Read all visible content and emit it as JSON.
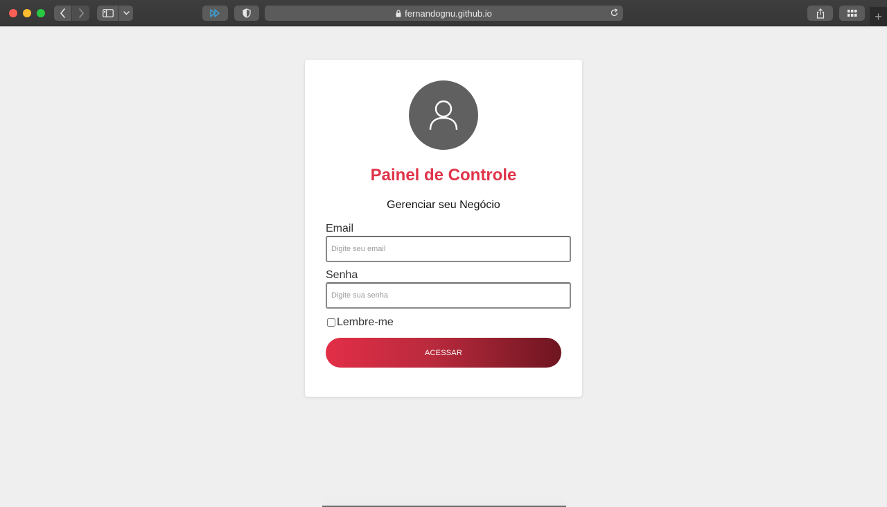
{
  "browser": {
    "url": "fernandognu.github.io",
    "newtab_glyph": "+",
    "icons": [
      "close-icon",
      "minimize-icon",
      "zoom-icon",
      "back-icon",
      "forward-icon",
      "sidebar-icon",
      "chevron-down-icon",
      "extension-icon",
      "shield-icon",
      "lock-icon",
      "reload-icon",
      "share-icon",
      "tab-overview-icon",
      "plus-icon"
    ]
  },
  "login": {
    "title": "Painel de Controle",
    "subtitle": "Gerenciar seu Negócio",
    "email_label": "Email",
    "email_placeholder": "Digite seu email",
    "password_label": "Senha",
    "password_placeholder": "Digite sua senha",
    "remember_label": "Lembre-me",
    "remember_checked": false,
    "submit_label": "ACESSAR",
    "colors": {
      "accent": "#e0344a",
      "button_start": "#e22e47",
      "button_end": "#6e1520",
      "avatar_bg": "#606060"
    }
  }
}
